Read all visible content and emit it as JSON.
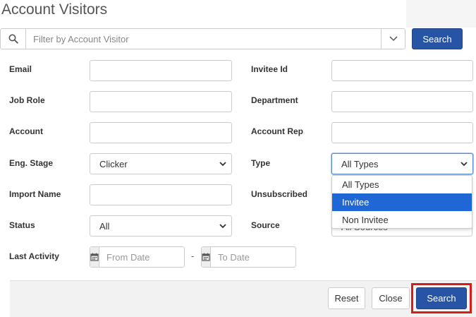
{
  "page": {
    "title": "Account Visitors"
  },
  "searchbar": {
    "placeholder": "Filter by Account Visitor",
    "button_label": "Search"
  },
  "form": {
    "email": {
      "label": "Email",
      "value": ""
    },
    "invitee_id": {
      "label": "Invitee Id",
      "value": ""
    },
    "job_role": {
      "label": "Job Role",
      "value": ""
    },
    "department": {
      "label": "Department",
      "value": ""
    },
    "account": {
      "label": "Account",
      "value": ""
    },
    "account_rep": {
      "label": "Account Rep",
      "value": ""
    },
    "eng_stage": {
      "label": "Eng. Stage",
      "value": "Clicker"
    },
    "type": {
      "label": "Type",
      "value": "All Types",
      "options": [
        "All Types",
        "Invitee",
        "Non Invitee"
      ],
      "highlighted_option": "Invitee"
    },
    "import_name": {
      "label": "Import Name",
      "value": ""
    },
    "unsubscribed": {
      "label": "Unsubscribed"
    },
    "status": {
      "label": "Status",
      "value": "All"
    },
    "source": {
      "label": "Source",
      "value": "All Sources"
    },
    "last_activity": {
      "label": "Last Activity",
      "from_placeholder": "From Date",
      "to_placeholder": "To Date",
      "separator": "-"
    }
  },
  "footer": {
    "reset_label": "Reset",
    "close_label": "Close",
    "search_label": "Search"
  },
  "colors": {
    "primary": "#2754a4",
    "highlight_border": "#d81b1b",
    "dropdown_selected": "#1f66d6"
  }
}
